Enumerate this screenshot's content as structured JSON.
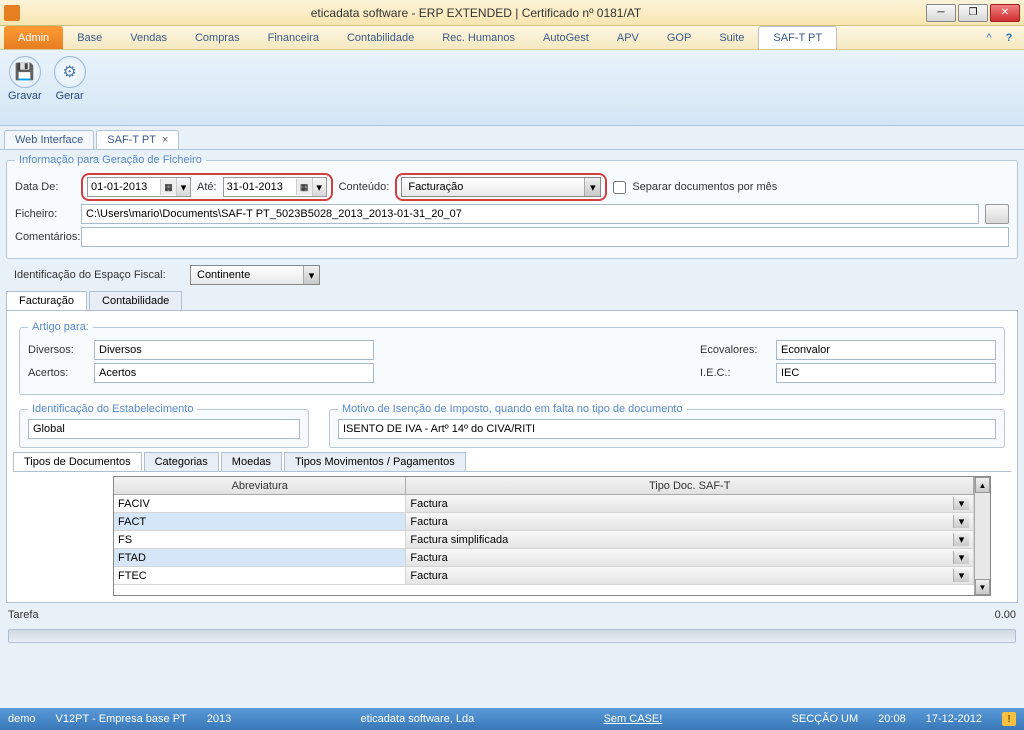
{
  "window": {
    "title": "eticadata software - ERP EXTENDED | Certificado nº 0181/AT"
  },
  "menu": {
    "admin": "Admin",
    "items": [
      "Base",
      "Vendas",
      "Compras",
      "Financeira",
      "Contabilidade",
      "Rec. Humanos",
      "AutoGest",
      "APV",
      "GOP",
      "Suite"
    ],
    "active": "SAF-T PT"
  },
  "ribbon": {
    "gravar": "Gravar",
    "gerar": "Gerar"
  },
  "doctabs": {
    "web": "Web Interface",
    "saft": "SAF-T PT"
  },
  "genInfo": {
    "legend": "Informação para Geração de Ficheiro",
    "dataDe_label": "Data De:",
    "dataDe": "01-01-2013",
    "ate_label": "Até:",
    "ate": "31-01-2013",
    "conteudo_label": "Conteúdo:",
    "conteudo": "Facturação",
    "separar_label": "Separar documentos por mês",
    "ficheiro_label": "Ficheiro:",
    "ficheiro": "C:\\Users\\mario\\Documents\\SAF-T PT_5023B5028_2013_2013-01-31_20_07",
    "comentarios_label": "Comentários:"
  },
  "fiscal": {
    "label": "Identificação do Espaço Fiscal:",
    "value": "Continente"
  },
  "innerTabs": {
    "facturacao": "Facturação",
    "contabilidade": "Contabilidade"
  },
  "artigo": {
    "legend": "Artigo para:",
    "diversos_label": "Diversos:",
    "diversos": "Diversos",
    "acertos_label": "Acertos:",
    "acertos": "Acertos",
    "ecovalores_label": "Ecovalores:",
    "ecovalores": "Econvalor",
    "iec_label": "I.E.C.:",
    "iec": "IEC"
  },
  "estabelecimento": {
    "legend": "Identificação do Estabelecimento",
    "value": "Global"
  },
  "motivo": {
    "legend": "Motivo de Isenção de Imposto, quando em falta no tipo de documento",
    "value": "ISENTO DE IVA - Artº 14º do CIVA/RITI"
  },
  "subtabs": {
    "tipos": "Tipos de Documentos",
    "categorias": "Categorias",
    "moedas": "Moedas",
    "movimentos": "Tipos Movimentos / Pagamentos"
  },
  "grid": {
    "col1": "Abreviatura",
    "col2": "Tipo Doc. SAF-T",
    "rows": [
      {
        "abrev": "FACIV",
        "tipo": "Factura",
        "sel": false
      },
      {
        "abrev": "FACT",
        "tipo": "Factura",
        "sel": true
      },
      {
        "abrev": "FS",
        "tipo": "Factura simplificada",
        "sel": false
      },
      {
        "abrev": "FTAD",
        "tipo": "Factura",
        "sel": true
      },
      {
        "abrev": "FTEC",
        "tipo": "Factura",
        "sel": false
      }
    ]
  },
  "task": {
    "label": "Tarefa",
    "value": "0.00"
  },
  "status": {
    "demo": "demo",
    "company": "V12PT - Empresa base PT",
    "year": "2013",
    "software": "eticadata software, Lda",
    "case": "Sem CASE!",
    "section": "SECÇÃO UM",
    "time": "20:08",
    "date": "17-12-2012"
  }
}
